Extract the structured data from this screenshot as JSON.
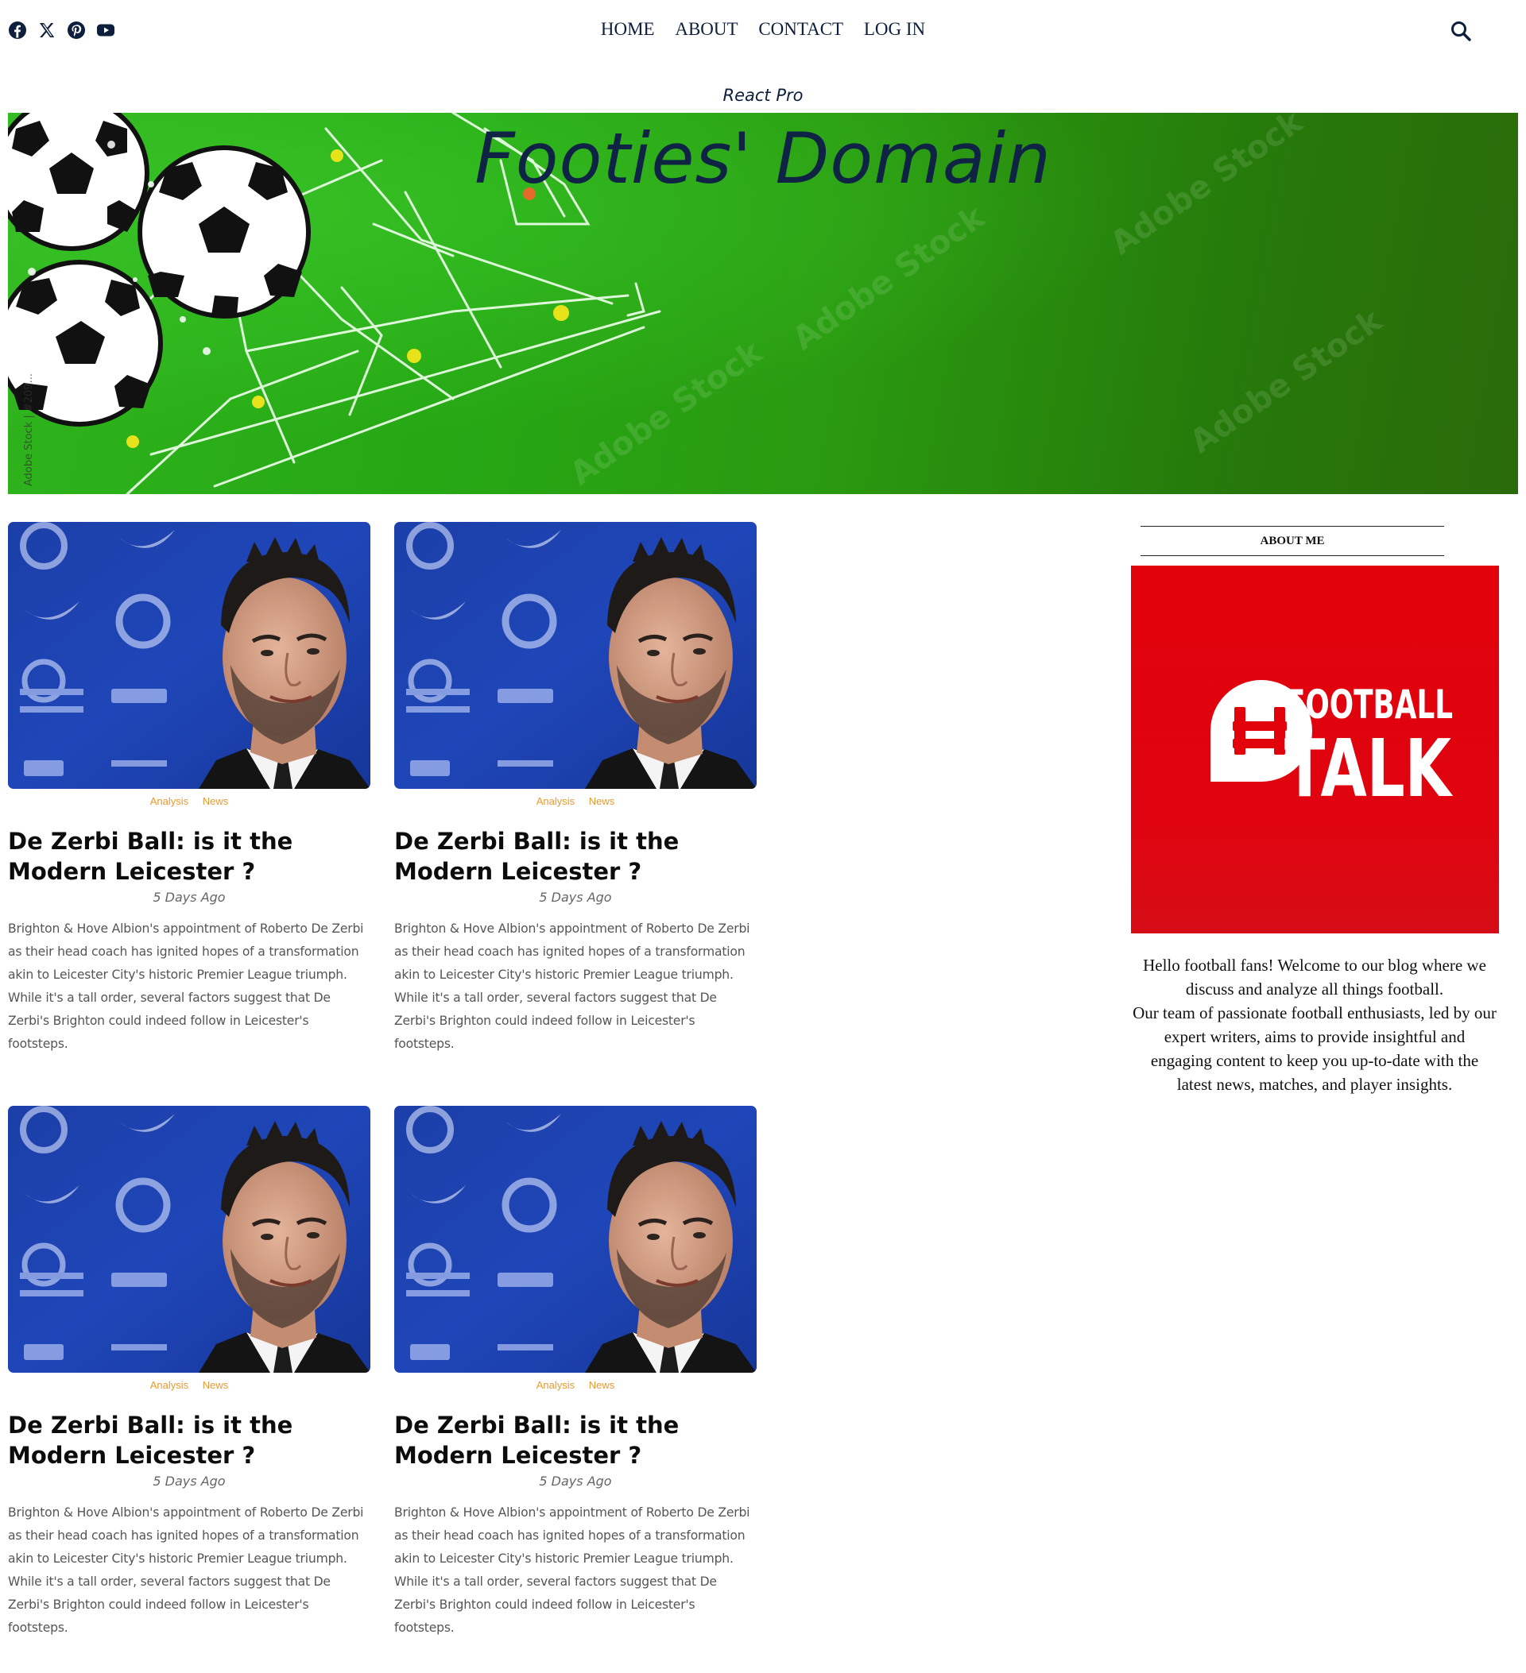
{
  "social": [
    {
      "icon": "facebook-icon"
    },
    {
      "icon": "x-twitter-icon"
    },
    {
      "icon": "pinterest-icon"
    },
    {
      "icon": "youtube-icon"
    }
  ],
  "nav": {
    "items": [
      "HOME",
      "ABOUT",
      "CONTACT",
      "LOG IN"
    ],
    "search_icon": "search-icon"
  },
  "brand": {
    "tagline": "React Pro",
    "title": "Footies' Domain",
    "hero_watermark": "Adobe Stock | #209..."
  },
  "colors": {
    "nav_text": "#0d1f3c",
    "category": "#e89a2e",
    "hero_green": "#2ba317",
    "ad_red": "#e1020b"
  },
  "posts": [
    {
      "categories": [
        "Analysis",
        "News"
      ],
      "title": "De Zerbi Ball: is it the Modern Leicester ?",
      "date": "5 Days Ago",
      "excerpt": "Brighton & Hove Albion's appointment of Roberto De Zerbi as their head coach has ignited hopes of a transformation akin to Leicester City's historic Premier League triumph. While it's a tall order, several factors suggest that De Zerbi's Brighton could indeed follow in Leicester's footsteps."
    },
    {
      "categories": [
        "Analysis",
        "News"
      ],
      "title": "De Zerbi Ball: is it the Modern Leicester ?",
      "date": "5 Days Ago",
      "excerpt": "Brighton & Hove Albion's appointment of Roberto De Zerbi as their head coach has ignited hopes of a transformation akin to Leicester City's historic Premier League triumph. While it's a tall order, several factors suggest that De Zerbi's Brighton could indeed follow in Leicester's footsteps."
    },
    {
      "categories": [
        "Analysis",
        "News"
      ],
      "title": "De Zerbi Ball: is it the Modern Leicester ?",
      "date": "5 Days Ago",
      "excerpt": "Brighton & Hove Albion's appointment of Roberto De Zerbi as their head coach has ignited hopes of a transformation akin to Leicester City's historic Premier League triumph. While it's a tall order, several factors suggest that De Zerbi's Brighton could indeed follow in Leicester's footsteps."
    },
    {
      "categories": [
        "Analysis",
        "News"
      ],
      "title": "De Zerbi Ball: is it the Modern Leicester ?",
      "date": "5 Days Ago",
      "excerpt": "Brighton & Hove Albion's appointment of Roberto De Zerbi as their head coach has ignited hopes of a transformation akin to Leicester City's historic Premier League triumph. While it's a tall order, several factors suggest that De Zerbi's Brighton could indeed follow in Leicester's footsteps."
    }
  ],
  "sidebar": {
    "heading": "ABOUT ME",
    "ad_line1": "FOOTBALL",
    "ad_line2": "TALK",
    "about_p1": "Hello football fans! Welcome to our blog where we discuss and analyze all things football.",
    "about_p2": "Our team of passionate football enthusiasts, led by our expert writers, aims to provide insightful and engaging content to keep you up-to-date with the latest news, matches, and player insights."
  }
}
